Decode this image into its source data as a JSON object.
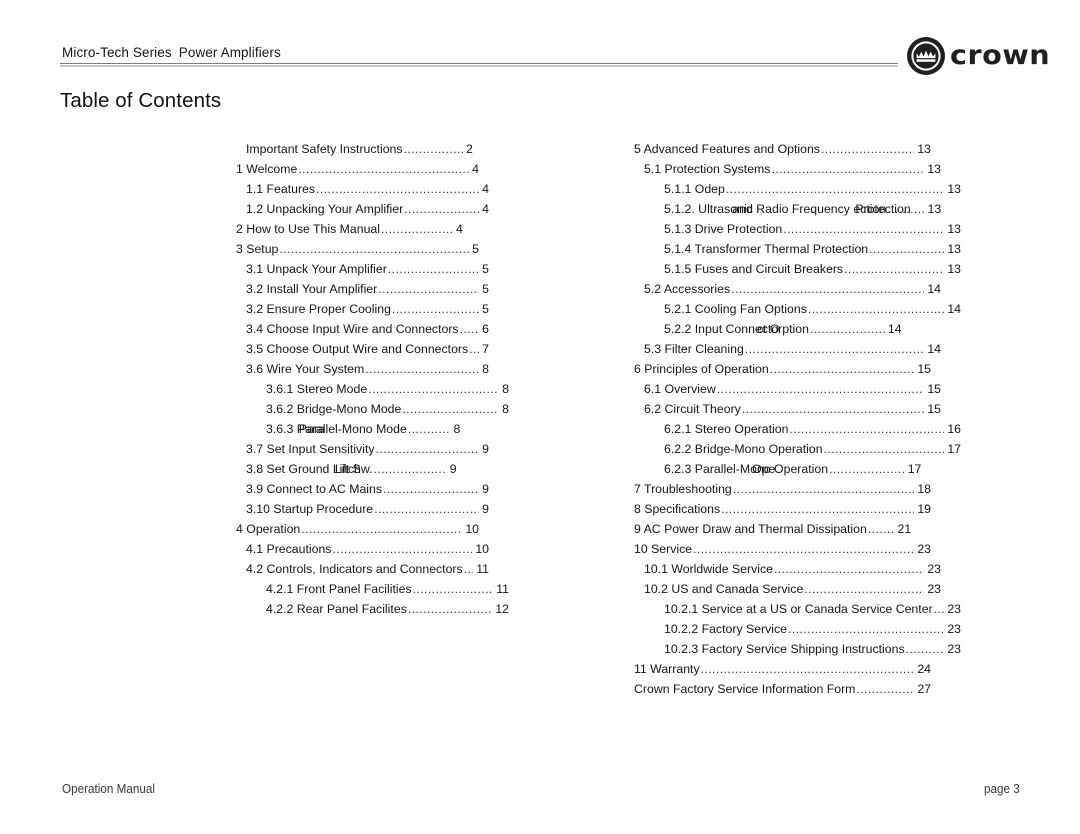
{
  "header": {
    "series": "Micro-Tech Series",
    "product": "Power Amplifiers",
    "logo_wordmark": "crown",
    "logo_icon": "crown-badge-icon"
  },
  "page_title": "Table of Contents",
  "footer": {
    "left": "Operation Manual",
    "right": "page 3"
  },
  "toc": {
    "left_column": [
      {
        "label": "Important Safety Instructions",
        "page": "2",
        "level": 1,
        "width": "w-84"
      },
      {
        "label": "1 Welcome",
        "page": "4",
        "level": 0,
        "width": "w-90"
      },
      {
        "label": "1.1 Features",
        "page": "4",
        "level": 1,
        "width": "w-90"
      },
      {
        "label": "1.2 Unpacking Your Amplifier",
        "page": "4",
        "level": 1,
        "width": "w-90"
      },
      {
        "label": "2 How to Use This Manual",
        "page": "4",
        "level": 0,
        "width": "w-84"
      },
      {
        "label": "3 Setup",
        "page": "5",
        "level": 0,
        "width": "w-90"
      },
      {
        "label": "3.1 Unpack Your Amplifier",
        "page": "5",
        "level": 1,
        "width": "w-90"
      },
      {
        "label": "3.2 Install Your Amplifier",
        "page": "5",
        "level": 1,
        "width": "w-90"
      },
      {
        "label": "3.2 Ensure Proper Cooling",
        "page": "5",
        "level": 1,
        "width": "w-90"
      },
      {
        "label": "3.4 Choose Input Wire and Connectors",
        "page": "6",
        "level": 1,
        "width": "w-90"
      },
      {
        "label": "3.5 Choose Output Wire and Connectors",
        "page": "7",
        "level": 1,
        "width": "w-90"
      },
      {
        "label": "3.6 Wire Your System",
        "page": "8",
        "level": 1,
        "width": "w-90"
      },
      {
        "label": "3.6.1 Stereo Mode",
        "page": "8",
        "level": 2,
        "width": "w-90"
      },
      {
        "label": "3.6.2 Bridge-Mono Mode",
        "page": "8",
        "level": 2,
        "width": "w-90"
      },
      {
        "label": "3.6.3 Parallel-Mono Mode",
        "page": "8",
        "level": 2,
        "width": "w-72",
        "overlap": {
          "prefix": "3.6.3 ",
          "under": "Parallel-",
          "over": "Para",
          "suffix": "Mono Mode"
        }
      },
      {
        "label": "3.7 Set Input Sensitivity",
        "page": "9",
        "level": 1,
        "width": "w-90"
      },
      {
        "label": "3.8 Set Ground Lift Switch",
        "page": "9",
        "level": 1,
        "width": "w-78",
        "overlap": {
          "prefix": "3.8 Set Ground ",
          "under": "Lift S",
          "over": "Litch",
          "suffix": "w."
        }
      },
      {
        "label": "3.9 Connect to AC Mains",
        "page": "9",
        "level": 1,
        "width": "w-90"
      },
      {
        "label": "3.10 Startup Procedure",
        "page": "9",
        "level": 1,
        "width": "w-90"
      },
      {
        "label": "4 Operation",
        "page": "10",
        "level": 0,
        "width": "w-90"
      },
      {
        "label": "4.1 Precautions",
        "page": "10",
        "level": 1,
        "width": "w-90"
      },
      {
        "label": "4.2 Controls, Indicators and Connectors",
        "page": "11",
        "level": 1,
        "width": "w-90"
      },
      {
        "label": "4.2.1 Front Panel Facilities",
        "page": "11",
        "level": 2,
        "width": "w-90"
      },
      {
        "label": "4.2.2 Rear Panel Facilites",
        "page": "12",
        "level": 2,
        "width": "w-90"
      }
    ],
    "right_column": [
      {
        "label": "5 Advanced Features and Options",
        "page": "13",
        "level": 0,
        "width": "w-90"
      },
      {
        "label": "5.1 Protection Systems",
        "page": "13",
        "level": 1,
        "width": "w-90"
      },
      {
        "label": "5.1.1 Odep",
        "page": "13",
        "level": 2,
        "width": "w-90"
      },
      {
        "label": "5.1.2. Ultrasonic and Radio Frequency Protection",
        "page": "13",
        "level": 2,
        "width": "w-84",
        "overlap": {
          "prefix": "5.1.2. Ultras",
          "under": "onic",
          "over": "and",
          "suffix": " Radio Frequency",
          "over2": "Protection",
          "tail": "ection"
        }
      },
      {
        "label": "5.1.3 Drive Protection",
        "page": "13",
        "level": 2,
        "width": "w-90"
      },
      {
        "label": "5.1.4 Transformer Thermal Protection",
        "page": "13",
        "level": 2,
        "width": "w-90"
      },
      {
        "label": "5.1.5 Fuses and Circuit Breakers",
        "page": "13",
        "level": 2,
        "width": "w-90"
      },
      {
        "label": "5.2 Accessories",
        "page": "14",
        "level": 1,
        "width": "w-90"
      },
      {
        "label": "5.2.1 Cooling Fan Options",
        "page": "14",
        "level": 2,
        "width": "w-90"
      },
      {
        "label": "5.2.2 Input Connector Option",
        "page": "14",
        "level": 2,
        "width": "w-72",
        "overlap": {
          "prefix": "5.2.2 Input Conn",
          "under": "ector",
          "over": "ct O",
          "suffix": "ption"
        }
      },
      {
        "label": "5.3 Filter Cleaning",
        "page": "14",
        "level": 1,
        "width": "w-90"
      },
      {
        "label": "6 Principles of Operation",
        "page": "15",
        "level": 0,
        "width": "w-90"
      },
      {
        "label": "6.1 Overview",
        "page": "15",
        "level": 1,
        "width": "w-90"
      },
      {
        "label": "6.2 Circuit Theory",
        "page": "15",
        "level": 1,
        "width": "w-90"
      },
      {
        "label": "6.2.1 Stereo Operation",
        "page": "16",
        "level": 2,
        "width": "w-90"
      },
      {
        "label": "6.2.2 Bridge-Mono Operation",
        "page": "17",
        "level": 2,
        "width": "w-90"
      },
      {
        "label": "6.2.3 Parallel-Mono Operation",
        "page": "17",
        "level": 2,
        "width": "w-78",
        "overlap": {
          "prefix": "6.2.3 Parallel-M",
          "under": "ono O",
          "over": "Ope",
          "suffix": "peration"
        }
      },
      {
        "label": "7 Troubleshooting",
        "page": "18",
        "level": 0,
        "width": "w-90"
      },
      {
        "label": "8 Specifications",
        "page": "19",
        "level": 0,
        "width": "w-90"
      },
      {
        "label": "9 AC Power Draw and Thermal Dissipation",
        "page": "21",
        "level": 0,
        "width": "w-84"
      },
      {
        "label": "10 Service",
        "page": "23",
        "level": 0,
        "width": "w-90"
      },
      {
        "label": "10.1 Worldwide Service",
        "page": "23",
        "level": 1,
        "width": "w-90"
      },
      {
        "label": "10.2 US and Canada Service",
        "page": "23",
        "level": 1,
        "width": "w-90"
      },
      {
        "label": "10.2.1 Service at a US or Canada Service Center",
        "page": "23",
        "level": 2,
        "width": "w-90"
      },
      {
        "label": "10.2.2 Factory Service",
        "page": "23",
        "level": 2,
        "width": "w-90"
      },
      {
        "label": "10.2.3 Factory Service Shipping Instructions",
        "page": "23",
        "level": 2,
        "width": "w-90"
      },
      {
        "label": "11 Warranty",
        "page": "24",
        "level": 0,
        "width": "w-90"
      },
      {
        "label": "Crown Factory Service Information Form",
        "page": "27",
        "level": 0,
        "width": "w-90"
      }
    ]
  },
  "colors": {
    "text": "#161616",
    "rule_dark": "#7d7d7d",
    "rule_light": "#c9c9c9",
    "logo": "#231f20"
  }
}
